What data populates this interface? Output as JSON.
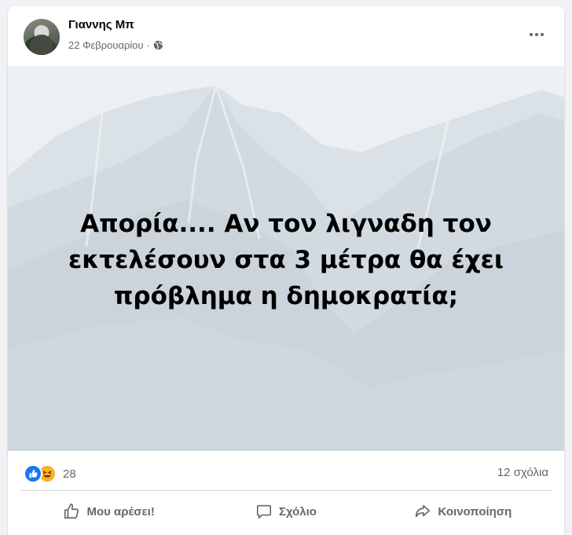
{
  "post": {
    "author": "Γιαννης Μπ",
    "date": "22 Φεβρουαρίου",
    "date_separator": "·",
    "privacy_icon": "globe-icon",
    "more_icon": "more-horizontal-icon",
    "text_lines": [
      "Απορία.... Αν τον λιγναδη τον",
      "εκτελέσουν στα 3 μέτρα θα έχει",
      "πρόβλημα η δημοκρατία;"
    ]
  },
  "stats": {
    "reaction_icons": [
      "like-reaction-icon",
      "haha-reaction-icon"
    ],
    "reactions_count": "28",
    "comments_count": "12 σχόλια"
  },
  "actions": {
    "like_label": "Μου αρέσει!",
    "comment_label": "Σχόλιο",
    "share_label": "Κοινοποίηση"
  },
  "colors": {
    "like_blue": "#1877f2",
    "haha_yellow": "#f7b125",
    "secondary_text": "#65676b",
    "background": "#f0f2f5"
  }
}
